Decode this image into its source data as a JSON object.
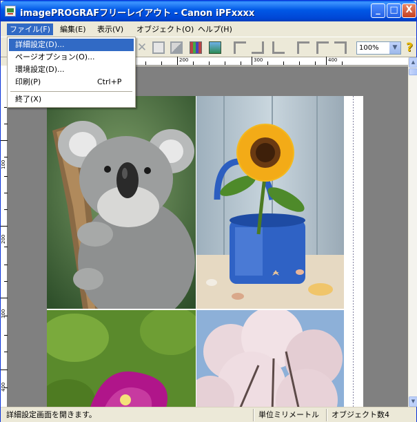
{
  "window": {
    "title": "imagePROGRAFフリーレイアウト - Canon iPFxxxx"
  },
  "title_buttons": {
    "minimize": "_",
    "maximize": "□",
    "close": "X"
  },
  "menubar": {
    "items": [
      "ファイル(F)",
      "編集(E)",
      "表示(V)",
      "オブジェクト(O)",
      "ヘルプ(H)"
    ],
    "active_index": 0
  },
  "file_menu": {
    "items": [
      {
        "label": "詳細設定(D)...",
        "shortcut": ""
      },
      {
        "label": "ページオプション(O)...",
        "shortcut": ""
      },
      {
        "label": "環境設定(D)...",
        "shortcut": ""
      },
      {
        "label": "印刷(P)",
        "shortcut": "Ctrl+P"
      },
      {
        "label": "終了(X)",
        "shortcut": ""
      }
    ],
    "highlighted_index": 0
  },
  "toolbar": {
    "icons": [
      "object-icon",
      "arrange-icon",
      "layout-icon",
      "photo-icon",
      "align-top-icon",
      "align-center-icon",
      "align-bottom-icon",
      "align-left-icon",
      "align-middle-icon",
      "align-right-icon"
    ],
    "zoom": "100%",
    "help_symbol": "?"
  },
  "ruler": {
    "top_labels": [
      "200",
      "300",
      "400"
    ],
    "left_labels": [
      "100",
      "200",
      "300",
      "400"
    ]
  },
  "photos": [
    {
      "subject": "koala",
      "colors": {
        "bg": "#3F6B3A",
        "fur": "#9A9C9C"
      }
    },
    {
      "subject": "sunflower in blue vase",
      "colors": {
        "bg": "#A9B8C2",
        "flower": "#F2B51D",
        "vase": "#2F5FB8"
      }
    },
    {
      "subject": "purple bougainvillea",
      "colors": {
        "bg": "#5E8A2E",
        "flower": "#B2148A"
      }
    },
    {
      "subject": "cherry blossoms",
      "colors": {
        "bg": "#8FB2D8",
        "blossom": "#EDD9DE"
      }
    }
  ],
  "statusbar": {
    "message": "詳細設定画面を開きます。",
    "unit": "単位ミリメートル",
    "object_count": "オブジェクト数4"
  }
}
